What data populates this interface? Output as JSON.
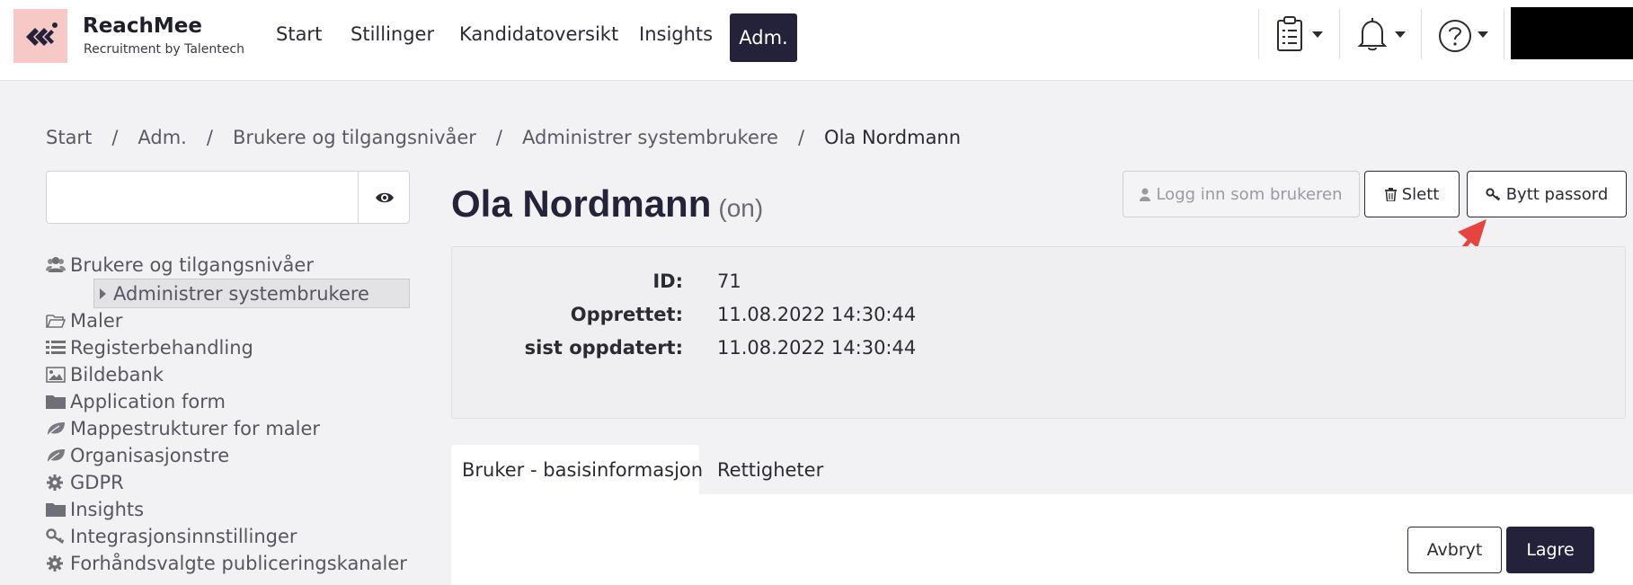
{
  "brand": {
    "name": "ReachMee",
    "tagline": "Recruitment by Talentech"
  },
  "nav": {
    "items": [
      {
        "label": "Start"
      },
      {
        "label": "Stillinger"
      },
      {
        "label": "Kandidatoversikt"
      },
      {
        "label": "Insights"
      }
    ],
    "active_label": "Adm."
  },
  "toolbar": {
    "icons": [
      "clipboard-icon",
      "bell-icon",
      "help-icon"
    ]
  },
  "breadcrumb": [
    "Start",
    "Adm.",
    "Brukere og tilgangsnivåer",
    "Administrer systembrukere",
    "Ola Nordmann"
  ],
  "breadcrumb_sep": "/",
  "sidebar": {
    "search_value": "",
    "items": [
      {
        "label": "Brukere og tilgangsnivåer",
        "icon": "users-icon"
      },
      {
        "label": "Administrer systembrukere",
        "icon": "caret-right-icon",
        "selected": true
      },
      {
        "label": "Maler",
        "icon": "folder-open-icon"
      },
      {
        "label": "Registerbehandling",
        "icon": "list-icon"
      },
      {
        "label": "Bildebank",
        "icon": "image-icon"
      },
      {
        "label": "Application form",
        "icon": "folder-icon"
      },
      {
        "label": "Mappestrukturer for maler",
        "icon": "leaf-icon"
      },
      {
        "label": "Organisasjonstre",
        "icon": "leaf-icon"
      },
      {
        "label": "GDPR",
        "icon": "gear-icon"
      },
      {
        "label": "Insights",
        "icon": "folder-icon"
      },
      {
        "label": "Integrasjonsinnstillinger",
        "icon": "key-icon"
      },
      {
        "label": "Forhåndsvalgte publiceringskanaler",
        "icon": "gear-icon"
      }
    ]
  },
  "user": {
    "name": "Ola Nordmann",
    "initials": "(on)",
    "fields": [
      {
        "label": "ID:",
        "value": "71"
      },
      {
        "label": "Opprettet:",
        "value": "11.08.2022 14:30:44"
      },
      {
        "label": "sist oppdatert:",
        "value": "11.08.2022 14:30:44"
      }
    ]
  },
  "actions": {
    "login_as": "Logg inn som brukeren",
    "delete": "Slett",
    "change_password": "Bytt passord"
  },
  "tabs": [
    {
      "label": "Bruker - basisinformasjon",
      "active": true
    },
    {
      "label": "Rettigheter",
      "active": false
    }
  ],
  "form_actions": {
    "cancel": "Avbryt",
    "save": "Lagre"
  },
  "colors": {
    "primary": "#23223a",
    "logo_bg": "#f7c9c6",
    "annotation_arrow": "#e5443f"
  }
}
